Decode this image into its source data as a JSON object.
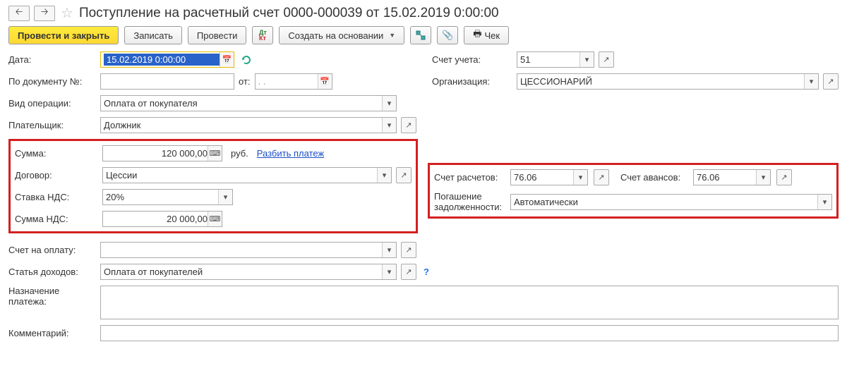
{
  "header": {
    "title": "Поступление на расчетный счет 0000-000039 от 15.02.2019 0:00:00"
  },
  "toolbar": {
    "post_close": "Провести и закрыть",
    "save": "Записать",
    "post": "Провести",
    "create_based": "Создать на основании",
    "check": "Чек"
  },
  "labels": {
    "date": "Дата:",
    "doc_no": "По документу №:",
    "from": "от:",
    "operation_type": "Вид операции:",
    "payer": "Плательщик:",
    "sum": "Сумма:",
    "contract": "Договор:",
    "vat_rate": "Ставка НДС:",
    "vat_sum": "Сумма НДС:",
    "invoice": "Счет на оплату:",
    "income_item": "Статья доходов:",
    "purpose": "Назначение платежа:",
    "comment": "Комментарий:",
    "account": "Счет учета:",
    "organization": "Организация:",
    "calc_account": "Счет расчетов:",
    "advance_account": "Счет авансов:",
    "debt_repay": "Погашение задолженности:",
    "currency": "руб.",
    "split": "Разбить платеж",
    "date_placeholder": ". ."
  },
  "values": {
    "date": "15.02.2019  0:00:00",
    "doc_no": "",
    "from": "",
    "operation_type": "Оплата от покупателя",
    "payer": "Должник",
    "sum": "120 000,00",
    "contract": "Цессии",
    "vat_rate": "20%",
    "vat_sum": "20 000,00",
    "invoice": "",
    "income_item": "Оплата от покупателей",
    "purpose": "",
    "comment": "",
    "account": "51",
    "organization": "ЦЕССИОНАРИЙ",
    "calc_account": "76.06",
    "advance_account": "76.06",
    "debt_repay": "Автоматически"
  }
}
